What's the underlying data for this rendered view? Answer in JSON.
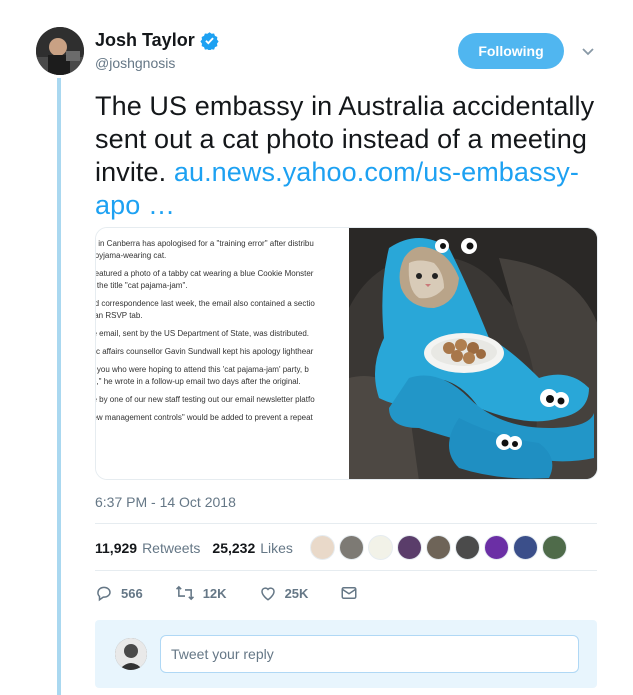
{
  "author": {
    "display_name": "Josh Taylor",
    "handle": "@joshgnosis",
    "verified": true
  },
  "follow_button": {
    "label": "Following",
    "color": "#50b6f0"
  },
  "tweet": {
    "text": "The US embassy in Australia accidentally sent out a cat photo instead of a meeting invite.",
    "link": "au.news.yahoo.com/us-embassy-apo …"
  },
  "media": {
    "article_lines": [
      "sy in Canberra has apologised for a \"training error\" after distribu",
      "a pyjama-wearing cat.",
      ", featured a photo of a tabby cat wearing a blue Cookie Monster",
      "th the title \"cat pajama-jam\".",
      "ted correspondence last week, the email also contained a sectio",
      "it an RSVP tab.",
      "he email, sent by the US Department of State, was distributed.",
      "blic affairs counsellor Gavin Sundwall kept his apology lighthear",
      "of you who were hoping to attend this 'cat pajama-jam' party, b",
      "se,\" he wrote in a follow-up email two days after the original.",
      "de by one of our new staff testing out our email newsletter platfo",
      "new management controls\" would be added to prevent a repeat"
    ],
    "photo": "tabby cat in blue cookie monster pajamas holding plate of cookies"
  },
  "timestamp": "6:37 PM - 14 Oct 2018",
  "stats": {
    "retweets_count": "11,929",
    "retweets_label": "Retweets",
    "likes_count": "25,232",
    "likes_label": "Likes"
  },
  "actions": {
    "reply_count": "566",
    "retweet_count": "12K",
    "like_count": "25K"
  },
  "reply": {
    "placeholder": "Tweet your reply"
  },
  "colors": {
    "accent": "#1da1f2",
    "thread_line": "#aad8f0",
    "muted": "#657786"
  },
  "icons": [
    "verified-icon",
    "chevron-down-icon",
    "reply-icon",
    "retweet-icon",
    "heart-icon",
    "dm-icon"
  ]
}
